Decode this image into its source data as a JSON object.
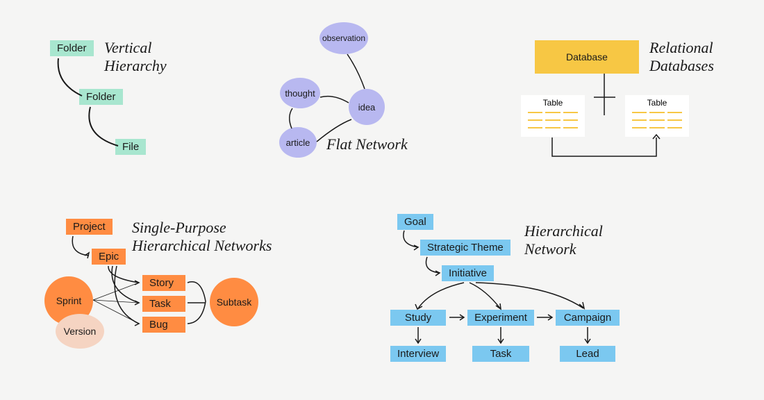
{
  "diagrams": {
    "vertical_hierarchy": {
      "title": "Vertical\nHierarchy",
      "nodes": [
        "Folder",
        "Folder",
        "File"
      ]
    },
    "flat_network": {
      "title": "Flat Network",
      "nodes": [
        "observation",
        "thought",
        "idea",
        "article"
      ]
    },
    "relational_databases": {
      "title": "Relational\nDatabases",
      "root": "Database",
      "children": [
        "Table",
        "Table"
      ]
    },
    "single_purpose": {
      "title": "Single-Purpose\nHierarchical Networks",
      "project": "Project",
      "epic": "Epic",
      "items": [
        "Story",
        "Task",
        "Bug"
      ],
      "sprint": "Sprint",
      "version": "Version",
      "subtask": "Subtask"
    },
    "hierarchical_network": {
      "title": "Hierarchical\nNetwork",
      "goal": "Goal",
      "theme": "Strategic Theme",
      "initiative": "Initiative",
      "row1": [
        "Study",
        "Experiment",
        "Campaign"
      ],
      "row2": [
        "Interview",
        "Task",
        "Lead"
      ]
    }
  }
}
